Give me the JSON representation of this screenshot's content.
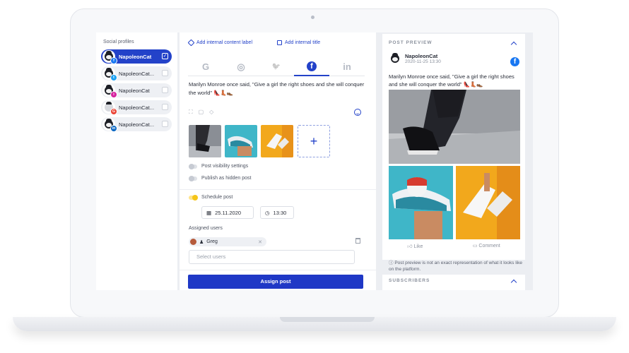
{
  "left": {
    "title": "Social profiles",
    "profiles": [
      {
        "name": "NapoleonCat",
        "network": "facebook",
        "badge": "f",
        "active": true
      },
      {
        "name": "NapoleonCat...",
        "network": "twitter",
        "badge": "t",
        "active": false
      },
      {
        "name": "NapoleonCat",
        "network": "instagram",
        "badge": "i",
        "active": false
      },
      {
        "name": "NapoleonCat...",
        "network": "google",
        "badge": "G",
        "active": false
      },
      {
        "name": "NapoleonCat...",
        "network": "linkedin",
        "badge": "in",
        "active": false
      }
    ]
  },
  "composer": {
    "add_label": "Add internal content label",
    "add_title": "Add internal title",
    "tabs": [
      {
        "icon": "google-icon",
        "glyph": "G"
      },
      {
        "icon": "instagram-icon",
        "glyph": "◎"
      },
      {
        "icon": "twitter-icon",
        "glyph": "🐦"
      },
      {
        "icon": "facebook-icon",
        "glyph": "f"
      },
      {
        "icon": "linkedin-icon",
        "glyph": "in"
      }
    ],
    "active_tab": "facebook",
    "post_text": "Marilyn Monroe once said, \"Give a girl the right shoes and she will conquer the world\" 👠👢👞",
    "add_media": "+",
    "visibility": "Post visibility settings",
    "hidden": "Publish as hidden post",
    "schedule": "Schedule post",
    "date": "25.11.2020",
    "time": "13:30",
    "assigned_users_label": "Assigned users",
    "assigned_user": "Greg",
    "select_placeholder": "Select users",
    "assign_button": "Assign post"
  },
  "preview": {
    "section_title": "POST PREVIEW",
    "name": "NapoleonCat",
    "date": "2020-11-25 13:30",
    "text": "Marilyn Monroe once said, \"Give a girl the right shoes and she will conquer the world\" 👠👢👞",
    "like": "Like",
    "comment": "Comment",
    "disclaimer": "Post preview is not an exact representation of what it looks like on the platform.",
    "subscribers_title": "SUBSCRIBERS"
  },
  "colors": {
    "accent": "#2342c9",
    "toggle_on": "#f5c518",
    "facebook": "#1877f2"
  }
}
